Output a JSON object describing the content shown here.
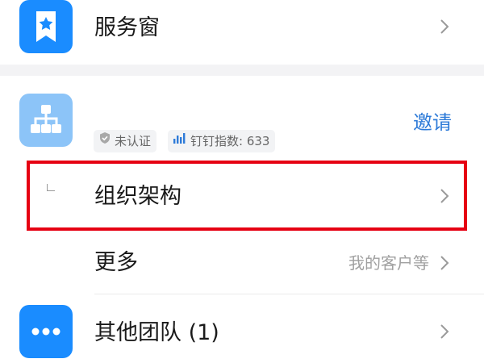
{
  "service": {
    "label": "服务窗",
    "icon": "star-bookmark-icon"
  },
  "org": {
    "icon": "org-chart-icon",
    "invite_label": "邀请",
    "badges": [
      {
        "icon": "shield-check-icon",
        "text": "未认证"
      },
      {
        "icon": "bar-chart-icon",
        "text": "钉钉指数: 633"
      }
    ]
  },
  "menu": {
    "structure_label": "组织架构",
    "more_label": "更多",
    "more_hint": "我的客户等"
  },
  "other": {
    "label": "其他团队 (1)",
    "icon": "more-dots-icon"
  },
  "colors": {
    "brand_blue": "#1a8cff",
    "light_blue": "#8cc4f8",
    "invite_blue": "#2e7bd8",
    "highlight_red": "#e60012"
  }
}
